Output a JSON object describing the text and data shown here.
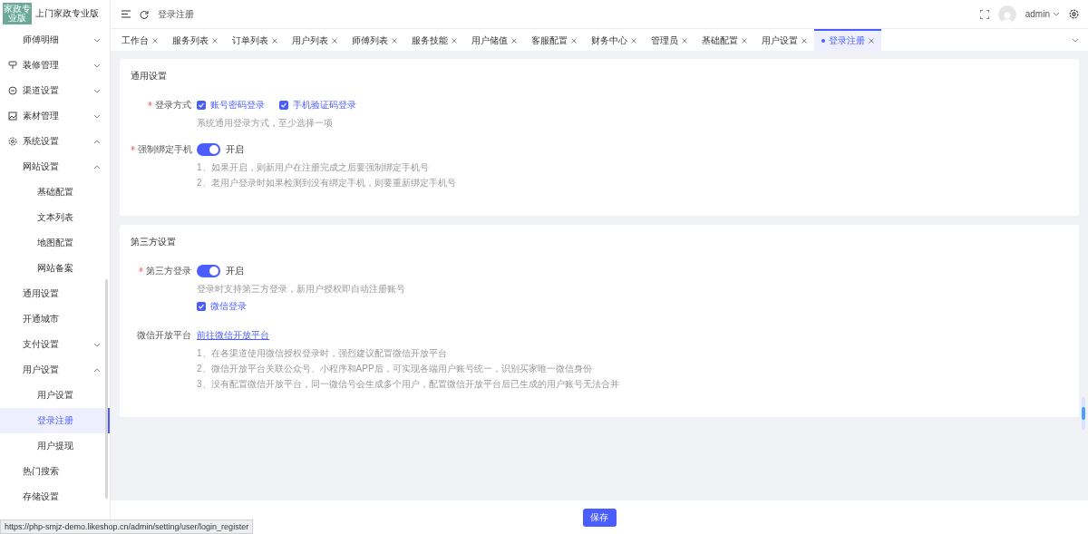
{
  "brand": {
    "logo": "家政专业版",
    "title": "上门家政专业版"
  },
  "header": {
    "breadcrumb": "登录注册",
    "user": "admin"
  },
  "tabs": [
    {
      "label": "工作台",
      "selected": false
    },
    {
      "label": "服务列表",
      "selected": false
    },
    {
      "label": "订单列表",
      "selected": false
    },
    {
      "label": "用户列表",
      "selected": false
    },
    {
      "label": "师傅列表",
      "selected": false
    },
    {
      "label": "服务技能",
      "selected": false
    },
    {
      "label": "用户储值",
      "selected": false
    },
    {
      "label": "客服配置",
      "selected": false
    },
    {
      "label": "财务中心",
      "selected": false
    },
    {
      "label": "管理员",
      "selected": false
    },
    {
      "label": "基础配置",
      "selected": false
    },
    {
      "label": "用户设置",
      "selected": false
    },
    {
      "label": "登录注册",
      "selected": true
    }
  ],
  "sidebar": {
    "items": [
      {
        "label": "师傅明细",
        "expanded": false,
        "selected": false
      },
      {
        "label": "装修管理",
        "kind": "brush",
        "expanded": false,
        "selected": false
      },
      {
        "label": "渠道设置",
        "kind": "chat",
        "expanded": false,
        "selected": false
      },
      {
        "label": "素材管理",
        "kind": "image",
        "expanded": false,
        "selected": false
      },
      {
        "label": "系统设置",
        "kind": "gear",
        "expanded": true,
        "selected": false,
        "children": [
          {
            "label": "网站设置",
            "expanded": true,
            "selected": false,
            "children": [
              {
                "label": "基础配置",
                "selected": false
              },
              {
                "label": "文本列表",
                "selected": false
              },
              {
                "label": "地图配置",
                "selected": false
              },
              {
                "label": "网站备案",
                "selected": false
              }
            ]
          },
          {
            "label": "通用设置",
            "selected": false
          },
          {
            "label": "开通城市",
            "selected": false
          },
          {
            "label": "支付设置",
            "expanded": false,
            "selected": false
          },
          {
            "label": "用户设置",
            "expanded": true,
            "selected": false,
            "children": [
              {
                "label": "用户设置",
                "selected": false
              },
              {
                "label": "登录注册",
                "selected": true
              },
              {
                "label": "用户提现",
                "selected": false
              }
            ]
          },
          {
            "label": "热门搜索",
            "selected": false
          },
          {
            "label": "存储设置",
            "selected": false
          }
        ]
      }
    ]
  },
  "sections": [
    {
      "title": "通用设置",
      "fields": [
        {
          "label": "登录方式",
          "required": true,
          "kind": "checkboxes",
          "options": [
            {
              "label": "账号密码登录",
              "checked": true
            },
            {
              "label": "手机验证码登录",
              "checked": true
            }
          ],
          "hints": [
            "系统通用登录方式，至少选择一项"
          ]
        },
        {
          "label": "强制绑定手机",
          "required": true,
          "kind": "switch",
          "on": true,
          "value": "开启",
          "hints": [
            "1、如果开启，则新用户在注册完成之后要强制绑定手机号",
            "2、老用户登录时如果检测到没有绑定手机，则要重新绑定手机号"
          ]
        }
      ]
    },
    {
      "title": "第三方设置",
      "fields": [
        {
          "label": "第三方登录",
          "required": true,
          "kind": "switch",
          "on": true,
          "value": "开启",
          "hints": [
            "登录时支持第三方登录，新用户授权即自动注册账号"
          ],
          "options": [
            {
              "label": "微信登录",
              "checked": true
            }
          ]
        },
        {
          "label": "微信开放平台",
          "required": false,
          "kind": "link",
          "value": "前往微信开放平台",
          "hints": [
            "1、在各渠道使用微信授权登录时，强烈建议配置微信开放平台",
            "2、微信开放平台关联公众号、小程序和APP后，可实现各端用户账号统一，识别买家唯一微信身份",
            "3、没有配置微信开放平台，同一微信号会生成多个用户，配置微信开放平台后已生成的用户账号无法合并"
          ]
        }
      ]
    }
  ],
  "footer": {
    "save": "保存"
  },
  "status_bar": "https://php-smjz-demo.likeshop.cn/admin/setting/user/login_register"
}
